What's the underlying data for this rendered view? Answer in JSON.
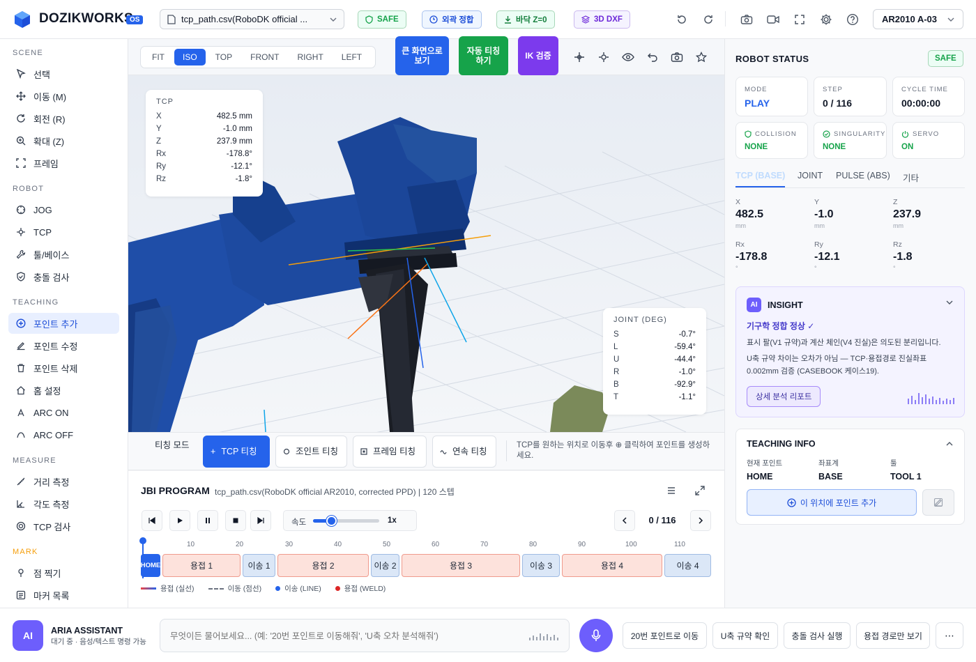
{
  "header": {
    "brand": "DOZIKWORKS",
    "version": "OS",
    "file_selector": "tcp_path.csv(RoboDK official ...",
    "badges": {
      "safe": "SAFE",
      "external_match": "외곽 정합",
      "floor": "바닥 Z=0",
      "dxf": "3D DXF"
    },
    "robot_selector": "AR2010 A-03"
  },
  "sidebar": {
    "sections": {
      "scene": "SCENE",
      "robot": "ROBOT",
      "teaching": "TEACHING",
      "measure": "MEASURE",
      "mark": "MARK"
    },
    "scene_items": [
      "선택",
      "이동 (M)",
      "회전 (R)",
      "확대 (Z)",
      "프레임"
    ],
    "robot_items": [
      "JOG",
      "TCP",
      "툴/베이스",
      "충돌 검사"
    ],
    "teaching_items": [
      "포인트 추가",
      "포인트 수정",
      "포인트 삭제",
      "홈 설정",
      "ARC ON",
      "ARC OFF"
    ],
    "measure_items": [
      "거리 측정",
      "각도 측정",
      "TCP 검사"
    ],
    "mark_items": [
      "점 찍기",
      "마커 목록"
    ]
  },
  "viewport": {
    "view_tabs": [
      "FIT",
      "ISO",
      "TOP",
      "FRONT",
      "RIGHT",
      "LEFT"
    ],
    "active_view": "ISO",
    "big_buttons": {
      "fullscreen": "큰 화면으로 보기",
      "auto_teach": "자동 티칭 하기",
      "ik": "IK 검증"
    },
    "tcp_overlay": {
      "title": "TCP",
      "rows": [
        {
          "k": "X",
          "v": "482.5 mm"
        },
        {
          "k": "Y",
          "v": "-1.0 mm"
        },
        {
          "k": "Z",
          "v": "237.9 mm"
        },
        {
          "k": "Rx",
          "v": "-178.8°"
        },
        {
          "k": "Ry",
          "v": "-12.1°"
        },
        {
          "k": "Rz",
          "v": "-1.8°"
        }
      ]
    },
    "joint_overlay": {
      "title": "JOINT (DEG)",
      "rows": [
        {
          "k": "S",
          "v": "-0.7°"
        },
        {
          "k": "L",
          "v": "-59.4°"
        },
        {
          "k": "U",
          "v": "-44.4°"
        },
        {
          "k": "R",
          "v": "-1.0°"
        },
        {
          "k": "B",
          "v": "-92.9°"
        },
        {
          "k": "T",
          "v": "-1.1°"
        }
      ]
    }
  },
  "teaching_bar": {
    "mode_label": "티칭 모드",
    "buttons": [
      "TCP 티칭",
      "조인트 티칭",
      "프레임 티칭",
      "연속 티칭"
    ],
    "hint": "TCP를 원하는 위치로 이동후 ⊕ 클릭하여 포인트를 생성하세요."
  },
  "jbi": {
    "title": "JBI PROGRAM",
    "subtitle": "tcp_path.csv(RoboDK official AR2010, corrected PPD) | 120 스텝",
    "speed_label": "속도",
    "speed_value": "1x",
    "speed_fraction": 0.27,
    "step_counter": "0 / 116",
    "ticks": [
      "10",
      "20",
      "30",
      "40",
      "50",
      "60",
      "70",
      "80",
      "90",
      "100",
      "110"
    ],
    "segments": [
      "HOME",
      "용접 1",
      "이송 1",
      "용접 2",
      "이송 2",
      "용접 3",
      "이송 3",
      "용접 4",
      "이송 4"
    ],
    "legend": [
      "용접 (실선)",
      "이동 (점선)",
      "이송 (LINE)",
      "용접 (WELD)"
    ]
  },
  "status": {
    "title": "ROBOT STATUS",
    "badge": "SAFE",
    "cards": [
      {
        "label": "MODE",
        "value": "PLAY"
      },
      {
        "label": "STEP",
        "value": "0 / 116"
      },
      {
        "label": "CYCLE TIME",
        "value": "00:00:00"
      }
    ],
    "checks": [
      {
        "label": "COLLISION",
        "value": "NONE"
      },
      {
        "label": "SINGULARITY",
        "value": "NONE"
      },
      {
        "label": "SERVO",
        "value": "ON"
      }
    ],
    "tabs": [
      "TCP (BASE)",
      "JOINT",
      "PULSE (ABS)",
      "기타"
    ],
    "coords": [
      {
        "label": "X",
        "value": "482.5",
        "unit": "mm"
      },
      {
        "label": "Y",
        "value": "-1.0",
        "unit": "mm"
      },
      {
        "label": "Z",
        "value": "237.9",
        "unit": "mm"
      },
      {
        "label": "Rx",
        "value": "-178.8",
        "unit": "°"
      },
      {
        "label": "Ry",
        "value": "-12.1",
        "unit": "°"
      },
      {
        "label": "Rz",
        "value": "-1.8",
        "unit": "°"
      }
    ]
  },
  "insight": {
    "badge": "AI",
    "title": "INSIGHT",
    "headline": "기구학 정합 정상 ✓",
    "line1": "표시 팔(V1 규약)과 계산 체인(V4 진실)은 의도된 분리입니다.",
    "line2": "U축 규약 차이는 오차가 아님 — TCP·용접경로 진실좌표 0.002mm 검증 (CASEBOOK 케이스19).",
    "report_button": "상세 분석 리포트"
  },
  "teaching_info": {
    "title": "TEACHING INFO",
    "fields": [
      {
        "label": "현재 포인트",
        "value": "HOME"
      },
      {
        "label": "좌표계",
        "value": "BASE"
      },
      {
        "label": "툴",
        "value": "TOOL 1"
      }
    ],
    "add_button": "이 위치에 포인트 추가"
  },
  "assistant": {
    "badge": "AI",
    "name": "ARIA ASSISTANT",
    "status": "대기 중 · 음성/텍스트 명령 가능",
    "placeholder": "무엇이든 물어보세요... (예: '20번 포인트로 이동해줘', 'U축 오차 분석해줘')",
    "chips": [
      "20번 포인트로 이동",
      "U축 규약 확인",
      "충돌 검사 실행",
      "용접 경로만 보기"
    ],
    "more": "⋯"
  }
}
